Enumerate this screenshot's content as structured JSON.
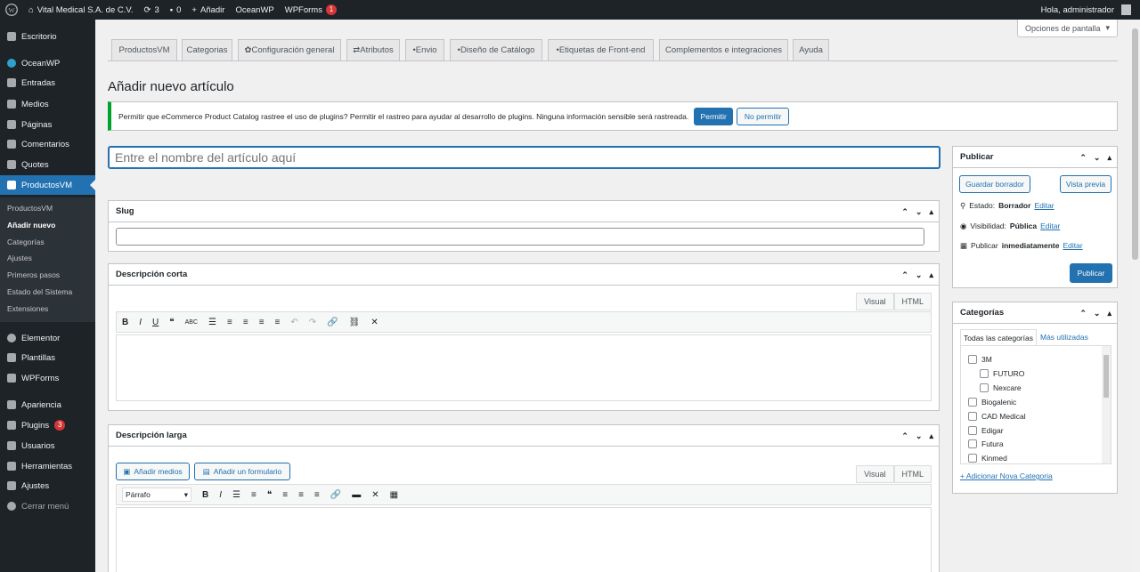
{
  "adminbar": {
    "site_name": "Vital Medical S.A. de C.V.",
    "updates_count": "3",
    "comments_count": "0",
    "new_label": "Añadir",
    "oceanwp": "OceanWP",
    "wpforms": "WPForms",
    "wpforms_badge": "1",
    "greeting": "Hola, administrador"
  },
  "sidebar": {
    "items": [
      {
        "label": "Escritorio",
        "icon": "dashboard-icon"
      },
      {
        "label": "OceanWP",
        "icon": "oceanwp-icon"
      },
      {
        "label": "Entradas",
        "icon": "pin-icon"
      },
      {
        "label": "Medios",
        "icon": "media-icon"
      },
      {
        "label": "Páginas",
        "icon": "pages-icon"
      },
      {
        "label": "Comentarios",
        "icon": "comments-icon"
      },
      {
        "label": "Quotes",
        "icon": "quotes-icon"
      },
      {
        "label": "ProductosVM",
        "icon": "cart-icon"
      },
      {
        "label": "Elementor",
        "icon": "elementor-icon"
      },
      {
        "label": "Plantillas",
        "icon": "templates-icon"
      },
      {
        "label": "WPForms",
        "icon": "wpforms-icon"
      },
      {
        "label": "Apariencia",
        "icon": "brush-icon"
      },
      {
        "label": "Plugins",
        "icon": "plugins-icon",
        "badge": "3"
      },
      {
        "label": "Usuarios",
        "icon": "users-icon"
      },
      {
        "label": "Herramientas",
        "icon": "tools-icon"
      },
      {
        "label": "Ajustes",
        "icon": "settings-icon"
      },
      {
        "label": "Cerrar menú",
        "icon": "collapse-icon"
      }
    ],
    "submenu": [
      "ProductosVM",
      "Añadir nuevo",
      "Categorías",
      "Ajustes",
      "Primeros pasos",
      "Estado del Sistema",
      "Extensiones"
    ]
  },
  "screen_options": "Opciones de pantalla",
  "tabs": [
    "ProductosVM",
    "Categorias",
    "Configuración general",
    "Atributos",
    "Envio",
    "Diseño de Catálogo",
    "Etiquetas de Front-end",
    "Complementos e integraciones",
    "Ayuda"
  ],
  "page_title": "Añadir nuevo artículo",
  "notice": {
    "text": "Permitir que eCommerce Product Catalog rastree el uso de plugins? Permitir el rastreo para ayudar al desarrollo de plugins. Ninguna información sensible será rastreada.",
    "allow": "Permitir",
    "deny": "No permitir"
  },
  "title_placeholder": "Entre el nombre del artículo aquí",
  "slug_box": {
    "title": "Slug"
  },
  "short_desc": {
    "title": "Descripción corta",
    "visual": "Visual",
    "html": "HTML"
  },
  "long_desc": {
    "title": "Descripción larga",
    "add_media": "Añadir medios",
    "add_form": "Añadir un formulario",
    "visual": "Visual",
    "html": "HTML",
    "format": "Párrafo"
  },
  "publish": {
    "title": "Publicar",
    "save_draft": "Guardar borrador",
    "preview": "Vista previa",
    "status_label": "Estado:",
    "status_value": "Borrador",
    "visibility_label": "Visibilidad:",
    "visibility_value": "Pública",
    "publish_label": "Publicar",
    "publish_value": "inmediatamente",
    "edit": "Editar",
    "publish_button": "Publicar"
  },
  "categories": {
    "title": "Categorías",
    "tab_all": "Todas las categorías",
    "tab_used": "Más utilizadas",
    "items": [
      {
        "label": "3M",
        "level": 0
      },
      {
        "label": "FUTURO",
        "level": 1
      },
      {
        "label": "Nexcare",
        "level": 1
      },
      {
        "label": "Biogalenic",
        "level": 0
      },
      {
        "label": "CAD Medical",
        "level": 0
      },
      {
        "label": "Edigar",
        "level": 0
      },
      {
        "label": "Futura",
        "level": 0
      },
      {
        "label": "Kinmed",
        "level": 0
      }
    ],
    "add_new": "+ Adicionar Nova Categoria"
  }
}
